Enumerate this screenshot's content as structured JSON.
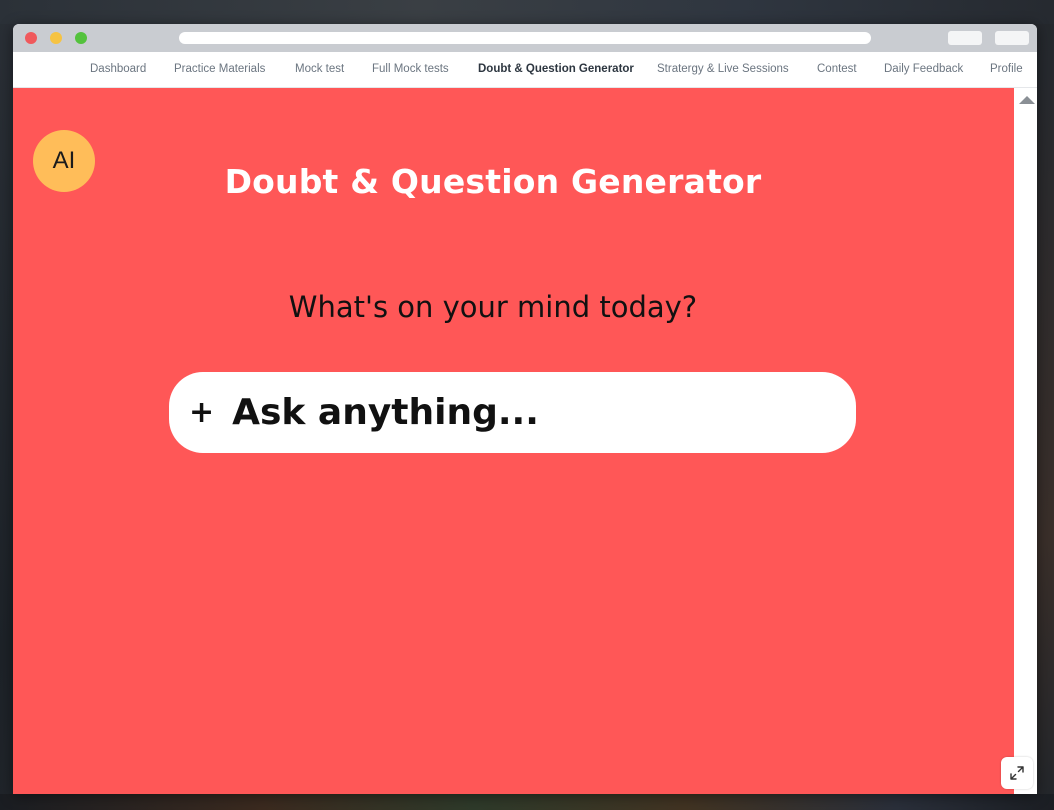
{
  "nav": {
    "items": [
      {
        "label": "Dashboard",
        "active": false
      },
      {
        "label": "Practice Materials",
        "active": false
      },
      {
        "label": "Mock test",
        "active": false
      },
      {
        "label": "Full Mock tests",
        "active": false
      },
      {
        "label": "Doubt & Question Generator",
        "active": true
      },
      {
        "label": "Stratergy & Live Sessions",
        "active": false
      },
      {
        "label": "Contest",
        "active": false
      },
      {
        "label": "Daily Feedback",
        "active": false
      },
      {
        "label": "Profile",
        "active": false
      }
    ]
  },
  "avatar": {
    "label": "AI"
  },
  "main": {
    "title": "Doubt & Question Generator",
    "prompt": "What's on your mind today?",
    "input": {
      "placeholder": "Ask anything...",
      "value": ""
    },
    "plus_label": "+"
  },
  "colors": {
    "background": "#ff5757",
    "avatar": "#ffbd59",
    "title": "#ffffff",
    "input_bg": "#ffffff"
  },
  "icons": {
    "plus": "plus-icon",
    "expand": "expand-icon",
    "scroll_up": "scroll-up-arrow-icon"
  }
}
